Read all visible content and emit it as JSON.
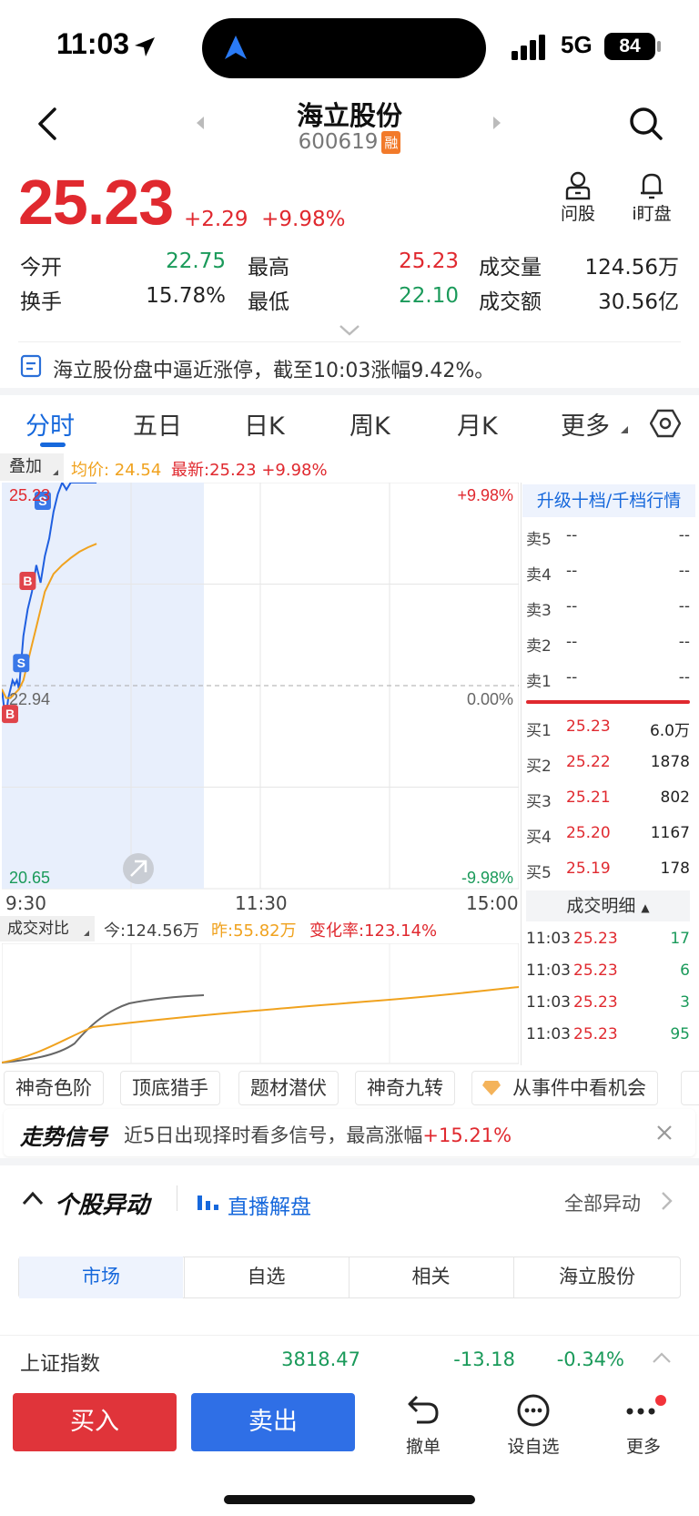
{
  "status_bar": {
    "time": "11:03",
    "network": "5G",
    "battery": "84"
  },
  "header": {
    "name": "海立股份",
    "code": "600619",
    "badge": "融"
  },
  "quote": {
    "price": "25.23",
    "change": "+2.29",
    "change_pct": "+9.98%",
    "open_label": "今开",
    "open": "22.75",
    "high_label": "最高",
    "high": "25.23",
    "volume_label": "成交量",
    "volume": "124.56万",
    "turnover_label": "换手",
    "turnover": "15.78%",
    "low_label": "最低",
    "low": "22.10",
    "amount_label": "成交额",
    "amount": "30.56亿"
  },
  "top_actions": {
    "ask": "问股",
    "watch": "i盯盘"
  },
  "notice": "海立股份盘中逼近涨停，截至10:03涨幅9.42%。",
  "tabs": [
    "分时",
    "五日",
    "日K",
    "周K",
    "月K",
    "更多"
  ],
  "chart_toolbar": {
    "overlay": "叠加",
    "avg": "均价: 24.54",
    "latest": "最新:25.23 +9.98%"
  },
  "chart_data": {
    "type": "line",
    "x_labels": [
      "9:30",
      "11:30",
      "15:00"
    ],
    "y_left": [
      "25.23",
      "22.94",
      "20.65"
    ],
    "y_right": [
      "+9.98%",
      "0.00%",
      "-9.98%"
    ],
    "ylim": [
      20.65,
      25.23
    ],
    "series": [
      {
        "name": "最新",
        "color": "#1f5fe0",
        "x": [
          0,
          1,
          2,
          3,
          4,
          5,
          6,
          7,
          8,
          9,
          10,
          12,
          14,
          16,
          18,
          20,
          22,
          24,
          26,
          28,
          30,
          32,
          34,
          36,
          38,
          40,
          42,
          44
        ],
        "values": [
          22.9,
          22.7,
          22.6,
          22.8,
          22.9,
          23.0,
          22.95,
          23.0,
          22.9,
          23.2,
          23.5,
          23.8,
          24.0,
          24.3,
          24.1,
          24.4,
          24.6,
          24.9,
          25.1,
          25.23,
          25.15,
          25.23,
          25.23,
          25.23,
          25.23,
          25.23,
          25.23,
          25.23
        ]
      },
      {
        "name": "均价",
        "color": "#f0a21e",
        "x": [
          0,
          2,
          4,
          6,
          8,
          10,
          12,
          14,
          16,
          18,
          20,
          24,
          28,
          32,
          36,
          40,
          44
        ],
        "values": [
          22.9,
          22.8,
          22.8,
          22.85,
          22.9,
          23.0,
          23.2,
          23.4,
          23.6,
          23.8,
          24.0,
          24.2,
          24.3,
          24.38,
          24.45,
          24.5,
          24.54
        ]
      }
    ],
    "markers": [
      {
        "label": "B",
        "x": 1,
        "value": 22.6,
        "color": "#e0444a"
      },
      {
        "label": "S",
        "x": 9,
        "value": 23.4,
        "color": "#3a78e8"
      },
      {
        "label": "B",
        "x": 12,
        "value": 24.1,
        "color": "#e0444a"
      },
      {
        "label": "S",
        "x": 19,
        "value": 25.23,
        "color": "#3a78e8"
      }
    ],
    "x_total": 240
  },
  "volume_compare": {
    "label": "成交对比",
    "today": "今:124.56万",
    "yesterday": "昨:55.82万",
    "rate": "变化率:123.14%"
  },
  "orderbook": {
    "upgrade": "升级十档/千档行情",
    "asks": [
      {
        "label": "卖5",
        "price": "--",
        "vol": "--"
      },
      {
        "label": "卖4",
        "price": "--",
        "vol": "--"
      },
      {
        "label": "卖3",
        "price": "--",
        "vol": "--"
      },
      {
        "label": "卖2",
        "price": "--",
        "vol": "--"
      },
      {
        "label": "卖1",
        "price": "--",
        "vol": "--"
      }
    ],
    "bids": [
      {
        "label": "买1",
        "price": "25.23",
        "vol": "6.0万"
      },
      {
        "label": "买2",
        "price": "25.22",
        "vol": "1878"
      },
      {
        "label": "买3",
        "price": "25.21",
        "vol": "802"
      },
      {
        "label": "买4",
        "price": "25.20",
        "vol": "1167"
      },
      {
        "label": "买5",
        "price": "25.19",
        "vol": "178"
      }
    ],
    "detail_title": "成交明细",
    "trades": [
      {
        "time": "11:03",
        "price": "25.23",
        "vol": "17"
      },
      {
        "time": "11:03",
        "price": "25.23",
        "vol": "6"
      },
      {
        "time": "11:03",
        "price": "25.23",
        "vol": "3"
      },
      {
        "time": "11:03",
        "price": "25.23",
        "vol": "95"
      }
    ]
  },
  "tools": [
    "神奇色阶",
    "顶底猎手",
    "题材潜伏",
    "神奇九转",
    "从事件中看机会"
  ],
  "signal": {
    "title": "走势信号",
    "text": "近5日出现择时看多信号，最高涨幅",
    "value": "+15.21%"
  },
  "movement": {
    "title": "个股异动",
    "live": "直播解盘",
    "all": "全部异动"
  },
  "segments": [
    "市场",
    "自选",
    "相关",
    "海立股份"
  ],
  "index_bar": {
    "name": "上证指数",
    "value": "3818.47",
    "change": "-13.18",
    "pct": "-0.34%"
  },
  "bottom": {
    "buy": "买入",
    "sell": "卖出",
    "cancel": "撤单",
    "fav": "设自选",
    "more": "更多"
  }
}
